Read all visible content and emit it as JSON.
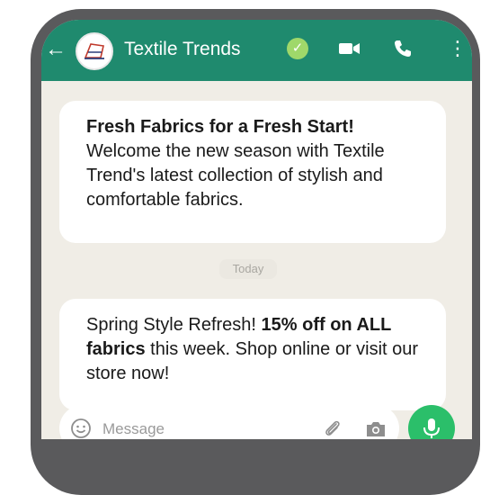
{
  "header": {
    "back_icon": "arrow-left-icon",
    "title": "Textile Trends",
    "verified_icon": "check-circle-icon",
    "verified_glyph": "✓",
    "video_icon": "video-camera-icon",
    "call_icon": "phone-icon",
    "menu_icon": "more-vertical-icon",
    "menu_glyph": "⋮",
    "colors": {
      "bar": "#1f8a6e",
      "verified": "#9fd86a"
    }
  },
  "messages": [
    {
      "headline": "Fresh Fabrics for a Fresh Start!",
      "body": "Welcome the new season with Textile Trend's latest collection of stylish and comfortable fabrics."
    },
    {
      "text_before": "Spring Style Refresh! ",
      "bold": "15% off on ALL fabrics",
      "text_after": " this week. Shop online or visit our store now!"
    }
  ],
  "date_divider": "Today",
  "composer": {
    "placeholder": "Message",
    "emoji_icon": "emoji-icon",
    "attach_icon": "paperclip-icon",
    "camera_icon": "camera-icon",
    "mic_icon": "microphone-icon",
    "colors": {
      "mic_button": "#2bbf6a"
    }
  },
  "chat_background": "#f0ede6"
}
